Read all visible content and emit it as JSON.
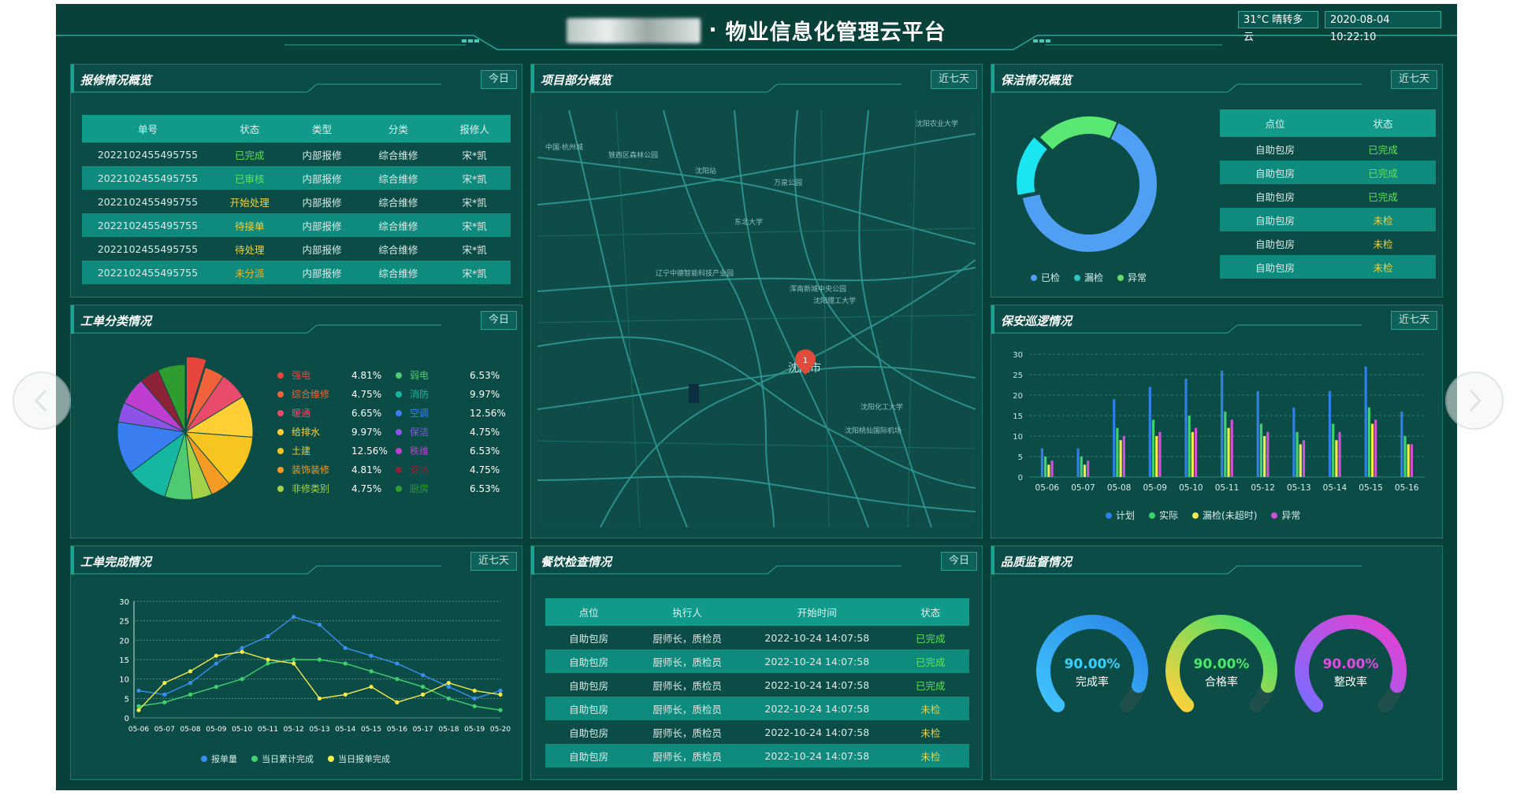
{
  "header": {
    "title": "物业信息化管理云平台",
    "title_prefix_sep": "·",
    "weather": "31°C 晴转多云",
    "datetime": "2020-08-04 10:22:10"
  },
  "colors": {
    "bg": "#08403a",
    "panel": "#0b4d46",
    "accent": "#119a8a",
    "green": "#62e063",
    "yellow": "#e9d34a"
  },
  "repair": {
    "title": "报修情况概览",
    "button": "今日",
    "columns": [
      "单号",
      "状态",
      "类型",
      "分类",
      "报修人"
    ],
    "rows": [
      {
        "id": "2022102455495755",
        "status": "已完成",
        "status_color": "#62e063",
        "type": "内部报修",
        "cat": "综合维修",
        "person": "宋*凯"
      },
      {
        "id": "2022102455495755",
        "status": "已审核",
        "status_color": "#62e063",
        "type": "内部报修",
        "cat": "综合维修",
        "person": "宋*凯"
      },
      {
        "id": "2022102455495755",
        "status": "开始处理",
        "status_color": "#e9d34a",
        "type": "内部报修",
        "cat": "综合维修",
        "person": "宋*凯"
      },
      {
        "id": "2022102455495755",
        "status": "待接单",
        "status_color": "#e9d34a",
        "type": "内部报修",
        "cat": "综合维修",
        "person": "宋*凯"
      },
      {
        "id": "2022102455495755",
        "status": "待处理",
        "status_color": "#e9d34a",
        "type": "内部报修",
        "cat": "综合维修",
        "person": "宋*凯"
      },
      {
        "id": "2022102455495755",
        "status": "未分派",
        "status_color": "#ffb020",
        "type": "内部报修",
        "cat": "综合维修",
        "person": "宋*凯"
      }
    ]
  },
  "project": {
    "title": "项目部分概览",
    "button": "近七天",
    "map_labels": [
      "中国·杭州城",
      "铁西区森林公园",
      "沈阳站",
      "万泉公园",
      "东北大学",
      "沈阳市",
      "浑南新城中央公园",
      "沈阳理工大学",
      "辽宁中德智能科技产业园",
      "沈阳桃仙国际机场",
      "沈阳化工大学",
      "沈阳农业大学"
    ],
    "marker": "1",
    "city": "沈阳市"
  },
  "cleaning": {
    "title": "保洁情况概览",
    "button": "近七天",
    "columns": [
      "点位",
      "状态"
    ],
    "rows": [
      {
        "point": "自助包房",
        "status": "已完成",
        "status_color": "#62e063"
      },
      {
        "point": "自助包房",
        "status": "已完成",
        "status_color": "#62e063"
      },
      {
        "point": "自助包房",
        "status": "已完成",
        "status_color": "#62e063"
      },
      {
        "point": "自助包房",
        "status": "未检",
        "status_color": "#e9d34a"
      },
      {
        "point": "自助包房",
        "status": "未检",
        "status_color": "#e9d34a"
      },
      {
        "point": "自助包房",
        "status": "未检",
        "status_color": "#e9d34a"
      }
    ],
    "legend": [
      {
        "name": "已检",
        "color": "#4f9ff5"
      },
      {
        "name": "漏检",
        "color": "#27c7c9"
      },
      {
        "name": "异常",
        "color": "#6fd86a"
      }
    ]
  },
  "workorder": {
    "title": "工单分类情况",
    "button": "今日",
    "items": [
      {
        "name": "强电",
        "value": "4.81%",
        "color": "#e8453c",
        "pct": 4.81
      },
      {
        "name": "综合维修",
        "value": "4.75%",
        "color": "#f0633a",
        "pct": 4.75
      },
      {
        "name": "暖通",
        "value": "6.65%",
        "color": "#e94b6a",
        "pct": 6.65
      },
      {
        "name": "给排水",
        "value": "9.97%",
        "color": "#ffcf33",
        "pct": 9.97
      },
      {
        "name": "土建",
        "value": "12.56%",
        "color": "#f7c51f",
        "pct": 12.56
      },
      {
        "name": "装饰装修",
        "value": "4.81%",
        "color": "#f59a23",
        "pct": 4.81
      },
      {
        "name": "非修类别",
        "value": "4.75%",
        "color": "#a4d14a",
        "pct": 4.75
      },
      {
        "name": "弱电",
        "value": "6.53%",
        "color": "#4ecb71",
        "pct": 6.53
      },
      {
        "name": "消防",
        "value": "9.97%",
        "color": "#15b7a0",
        "pct": 9.97
      },
      {
        "name": "空调",
        "value": "12.56%",
        "color": "#3a7df0",
        "pct": 12.56
      },
      {
        "name": "保洁",
        "value": "4.75%",
        "color": "#8d52e6",
        "pct": 4.75
      },
      {
        "name": "秩维",
        "value": "6.53%",
        "color": "#c03dd1",
        "pct": 6.53
      },
      {
        "name": "安防",
        "value": "4.75%",
        "color": "#8d2237",
        "pct": 4.75
      },
      {
        "name": "厨房",
        "value": "6.53%",
        "color": "#2f9c2f",
        "pct": 6.53
      }
    ]
  },
  "security": {
    "title": "保安巡逻情况",
    "button": "近七天",
    "legend": [
      {
        "name": "计划",
        "color": "#2f7fe8"
      },
      {
        "name": "实际",
        "color": "#3fd16f"
      },
      {
        "name": "漏检(未超时)",
        "color": "#f4ea4a"
      },
      {
        "name": "异常",
        "color": "#d34fd6"
      }
    ]
  },
  "completion": {
    "title": "工单完成情况",
    "button": "近七天",
    "legend": [
      {
        "name": "报单量",
        "color": "#3a8ef0"
      },
      {
        "name": "当日累计完成",
        "color": "#3fd16f"
      },
      {
        "name": "当日报单完成",
        "color": "#f4ea4a"
      }
    ]
  },
  "catering": {
    "title": "餐饮检查情况",
    "button": "今日",
    "columns": [
      "点位",
      "执行人",
      "开始时间",
      "状态"
    ],
    "rows": [
      {
        "point": "自助包房",
        "exec": "厨师长，质检员",
        "time": "2022-10-24 14:07:58",
        "status": "已完成",
        "status_color": "#62e063"
      },
      {
        "point": "自助包房",
        "exec": "厨师长，质检员",
        "time": "2022-10-24 14:07:58",
        "status": "已完成",
        "status_color": "#62e063"
      },
      {
        "point": "自助包房",
        "exec": "厨师长，质检员",
        "time": "2022-10-24 14:07:58",
        "status": "已完成",
        "status_color": "#62e063"
      },
      {
        "point": "自助包房",
        "exec": "厨师长，质检员",
        "time": "2022-10-24 14:07:58",
        "status": "未检",
        "status_color": "#e9d34a"
      },
      {
        "point": "自助包房",
        "exec": "厨师长，质检员",
        "time": "2022-10-24 14:07:58",
        "status": "未检",
        "status_color": "#e9d34a"
      },
      {
        "point": "自助包房",
        "exec": "厨师长，质检员",
        "time": "2022-10-24 14:07:58",
        "status": "未检",
        "status_color": "#e9d34a"
      }
    ]
  },
  "quality": {
    "title": "品质监督情况",
    "gauges": [
      {
        "value": "90.00%",
        "label": "完成率",
        "fraction": 0.9,
        "color_a": "#3fc4ff",
        "color_b": "#2a86e6",
        "val_color": "#39d2ff"
      },
      {
        "value": "90.00%",
        "label": "合格率",
        "fraction": 0.9,
        "color_a": "#ffd23a",
        "color_b": "#37e06b",
        "val_color": "#49e86a"
      },
      {
        "value": "90.00%",
        "label": "整改率",
        "fraction": 0.9,
        "color_a": "#7b6cff",
        "color_b": "#e73fd0",
        "val_color": "#e14be0"
      }
    ]
  },
  "chart_data": [
    {
      "type": "pie",
      "title": "",
      "categories": [
        "强电",
        "综合维修",
        "暖通",
        "给排水",
        "土建",
        "装饰装修",
        "非修类别",
        "弱电",
        "消防",
        "空调",
        "保洁",
        "秩维",
        "安防",
        "厨房"
      ],
      "values": [
        4.81,
        4.75,
        6.65,
        9.97,
        12.56,
        4.81,
        4.75,
        6.53,
        9.97,
        12.56,
        4.75,
        6.53,
        4.75,
        6.53
      ]
    },
    {
      "type": "pie",
      "title": "",
      "categories": [
        "已检",
        "漏检",
        "异常"
      ],
      "values": [
        65,
        15,
        20
      ]
    },
    {
      "type": "bar",
      "title": "",
      "categories": [
        "05-06",
        "05-07",
        "05-08",
        "05-09",
        "05-10",
        "05-11",
        "05-12",
        "05-13",
        "05-14",
        "05-15",
        "05-16"
      ],
      "ylim": [
        0,
        30
      ],
      "yticks": [
        0,
        5,
        10,
        15,
        20,
        25,
        30
      ],
      "series": [
        {
          "name": "计划",
          "values": [
            7,
            7,
            19,
            22,
            24,
            26,
            21,
            17,
            21,
            27,
            16
          ]
        },
        {
          "name": "实际",
          "values": [
            5,
            5,
            12,
            14,
            15,
            16,
            13,
            11,
            13,
            17,
            10
          ]
        },
        {
          "name": "漏检(未超时)",
          "values": [
            3,
            3,
            9,
            10,
            11,
            12,
            10,
            8,
            9,
            13,
            8
          ]
        },
        {
          "name": "异常",
          "values": [
            4,
            4,
            10,
            11,
            12,
            14,
            11,
            9,
            11,
            14,
            8
          ]
        }
      ]
    },
    {
      "type": "line",
      "title": "",
      "categories": [
        "05-06",
        "05-07",
        "05-08",
        "05-09",
        "05-10",
        "05-11",
        "05-12",
        "05-13",
        "05-14",
        "05-15",
        "05-16",
        "05-17",
        "05-18",
        "05-19",
        "05-20"
      ],
      "ylim": [
        0,
        30
      ],
      "yticks": [
        0,
        5,
        10,
        15,
        20,
        25,
        30
      ],
      "series": [
        {
          "name": "报单量",
          "values": [
            7,
            6,
            9,
            14,
            18,
            21,
            26,
            24,
            18,
            16,
            14,
            11,
            8,
            5,
            7
          ]
        },
        {
          "name": "当日累计完成",
          "values": [
            3,
            4,
            6,
            8,
            10,
            14,
            15,
            15,
            14,
            12,
            10,
            8,
            5,
            3,
            2
          ]
        },
        {
          "name": "当日报单完成",
          "values": [
            2,
            9,
            12,
            16,
            17,
            15,
            14,
            5,
            6,
            8,
            4,
            6,
            9,
            7,
            6
          ]
        }
      ]
    }
  ]
}
